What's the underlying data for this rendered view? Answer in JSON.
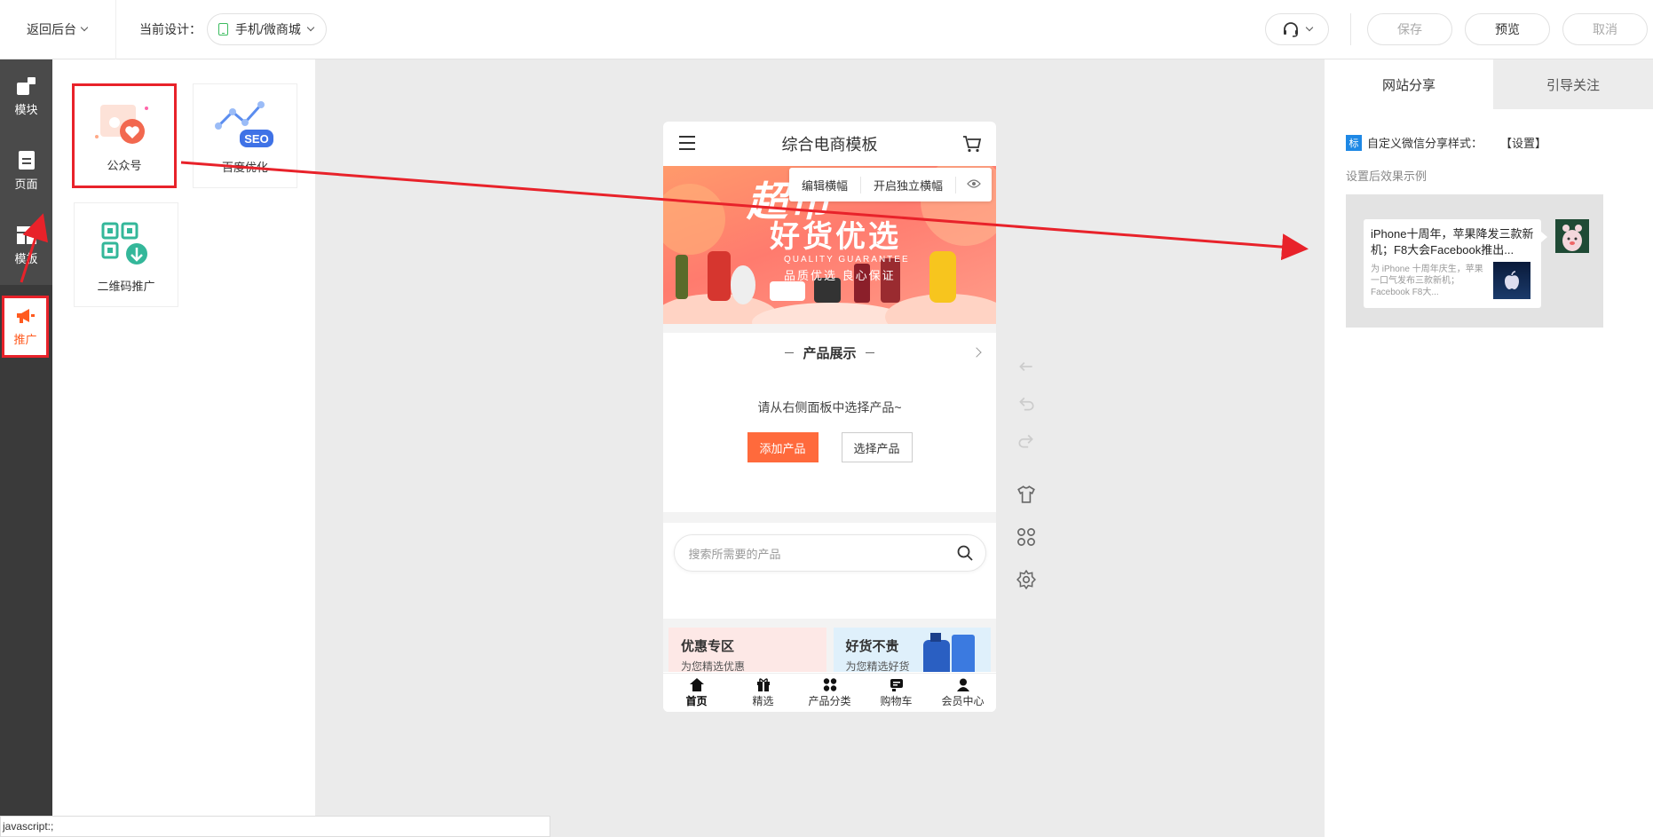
{
  "topbar": {
    "back_label": "返回后台",
    "current_design_label": "当前设计：",
    "design_selected": "手机/微商城",
    "save_label": "保存",
    "preview_label": "预览",
    "cancel_label": "取消"
  },
  "rail": {
    "items": [
      {
        "label": "模块",
        "icon": "module-icon"
      },
      {
        "label": "页面",
        "icon": "page-icon"
      },
      {
        "label": "模板",
        "icon": "template-icon"
      },
      {
        "label": "推广",
        "icon": "megaphone-icon"
      }
    ]
  },
  "panel": {
    "cards": [
      {
        "label": "公众号",
        "icon": "heart-photo-icon"
      },
      {
        "label": "百度优化",
        "icon": "seo-icon"
      },
      {
        "label": "二维码推广",
        "icon": "qr-code-icon"
      }
    ]
  },
  "phone": {
    "title": "综合电商模板",
    "banner_tools": {
      "edit": "编辑横幅",
      "independent": "开启独立横幅"
    },
    "banner": {
      "title1": "超市",
      "title2": "好货优选",
      "sub1": "QUALITY GUARANTEE",
      "sub2": "品质优选 良心保证"
    },
    "section_title": "产品展示",
    "empty_tip": "请从右侧面板中选择产品~",
    "add_button": "添加产品",
    "select_button": "选择产品",
    "search_placeholder": "搜索所需要的产品",
    "promos": [
      {
        "title": "优惠专区",
        "subtitle": "为您精选优惠"
      },
      {
        "title": "好货不贵",
        "subtitle": "为您精选好货"
      }
    ],
    "tabs": [
      {
        "label": "首页",
        "icon": "home-icon"
      },
      {
        "label": "精选",
        "icon": "gift-icon"
      },
      {
        "label": "产品分类",
        "icon": "grid-icon"
      },
      {
        "label": "购物车",
        "icon": "cart-icon"
      },
      {
        "label": "会员中心",
        "icon": "user-icon"
      }
    ]
  },
  "right_panel": {
    "tabs": [
      "网站分享",
      "引导关注"
    ],
    "badge": "标",
    "custom_label": "自定义微信分享样式：",
    "set_link": "【设置】",
    "example_note": "设置后效果示例",
    "example_title": "iPhone十周年，苹果降发三款新机；F8大会Facebook推出...",
    "example_desc": "为 iPhone 十周年庆生，苹果一口气发布三款新机；Facebook F8大..."
  },
  "status_bar": "javascript:;",
  "colors": {
    "accent": "#ff6a3c",
    "annotation": "#e8222a",
    "rail": "#3a3a3a"
  }
}
